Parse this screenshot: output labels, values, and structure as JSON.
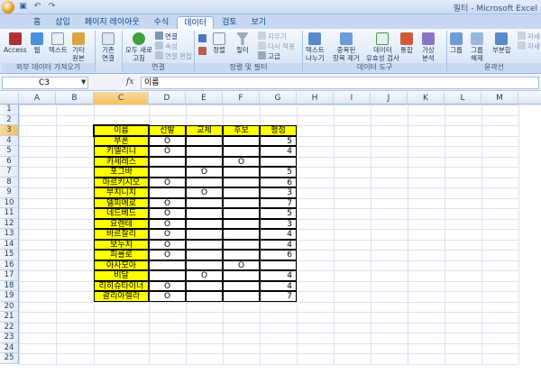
{
  "window": {
    "title": "필터 - Microsoft Excel"
  },
  "quick_access": [
    "save-icon",
    "undo-icon",
    "redo-icon"
  ],
  "tabs": [
    {
      "label": "홈"
    },
    {
      "label": "삽입"
    },
    {
      "label": "페이지 레이아웃"
    },
    {
      "label": "수식"
    },
    {
      "label": "데이터",
      "active": true
    },
    {
      "label": "검토"
    },
    {
      "label": "보기"
    }
  ],
  "ribbon": {
    "groups": {
      "external": "외부 데이터 가져오기",
      "connections": "연결",
      "sort_filter": "정렬 및 필터",
      "data_tools": "데이터 도구",
      "outline": "윤곽선"
    },
    "buttons": {
      "access": "Access",
      "web": "웹",
      "text": "텍스트",
      "other": "기타",
      "other2": "원본",
      "existing": "기존",
      "existing2": "연결",
      "refresh_all": "모두 새로",
      "refresh_all2": "고침",
      "conn": "연결",
      "props": "속성",
      "edit_links": "연결 편집",
      "sort": "정렬",
      "filter": "필터",
      "clear": "지우기",
      "reapply": "다시 적용",
      "advanced": "고급",
      "text_to_cols": "텍스트",
      "text_to_cols2": "나누기",
      "remove_dup": "중복된",
      "remove_dup2": "항목 제거",
      "validation": "데이터",
      "validation2": "유효성 검사",
      "consolidate": "통합",
      "whatif": "가상",
      "whatif2": "분석",
      "group": "그룹",
      "ungroup": "그룹",
      "ungroup2": "해제",
      "subtotal": "부분합",
      "show_detail": "자세히",
      "hide_detail": "자세히"
    }
  },
  "formula_bar": {
    "name_box": "C3",
    "fx": "fx",
    "content": "이름"
  },
  "columns": [
    "A",
    "B",
    "C",
    "D",
    "E",
    "F",
    "G",
    "H",
    "I",
    "J",
    "K",
    "L",
    "M"
  ],
  "rows": [
    "1",
    "2",
    "3",
    "4",
    "5",
    "6",
    "7",
    "8",
    "9",
    "10",
    "11",
    "12",
    "13",
    "14",
    "15",
    "16",
    "17",
    "18",
    "19",
    "20",
    "21",
    "22",
    "23",
    "24",
    "25"
  ],
  "table": {
    "headers": [
      "이름",
      "선발",
      "교체",
      "후보",
      "평점"
    ],
    "rows": [
      [
        "부폰",
        "O",
        "",
        "",
        "5"
      ],
      [
        "키엘리니",
        "O",
        "",
        "",
        "4"
      ],
      [
        "카세레스",
        "",
        "",
        "O",
        ""
      ],
      [
        "포그바",
        "",
        "O",
        "",
        "5"
      ],
      [
        "마르키시오",
        "O",
        "",
        "",
        "6"
      ],
      [
        "부치니치",
        "",
        "O",
        "",
        "3"
      ],
      [
        "델피에로",
        "O",
        "",
        "",
        "7"
      ],
      [
        "네드베드",
        "O",
        "",
        "",
        "5"
      ],
      [
        "요렌테",
        "O",
        "",
        "",
        "3"
      ],
      [
        "바르잘리",
        "O",
        "",
        "",
        "4"
      ],
      [
        "보누치",
        "O",
        "",
        "",
        "4"
      ],
      [
        "피를로",
        "O",
        "",
        "",
        "6"
      ],
      [
        "아사모아",
        "",
        "",
        "O",
        ""
      ],
      [
        "비달",
        "",
        "O",
        "",
        "4"
      ],
      [
        "리히슈타이너",
        "O",
        "",
        "",
        "4"
      ],
      [
        "괄리아렐라",
        "O",
        "",
        "",
        "7"
      ]
    ]
  },
  "colors": {
    "highlight": "#ffff00",
    "ribbon": "#dce8f7",
    "selected_header": "#f1c15f"
  }
}
